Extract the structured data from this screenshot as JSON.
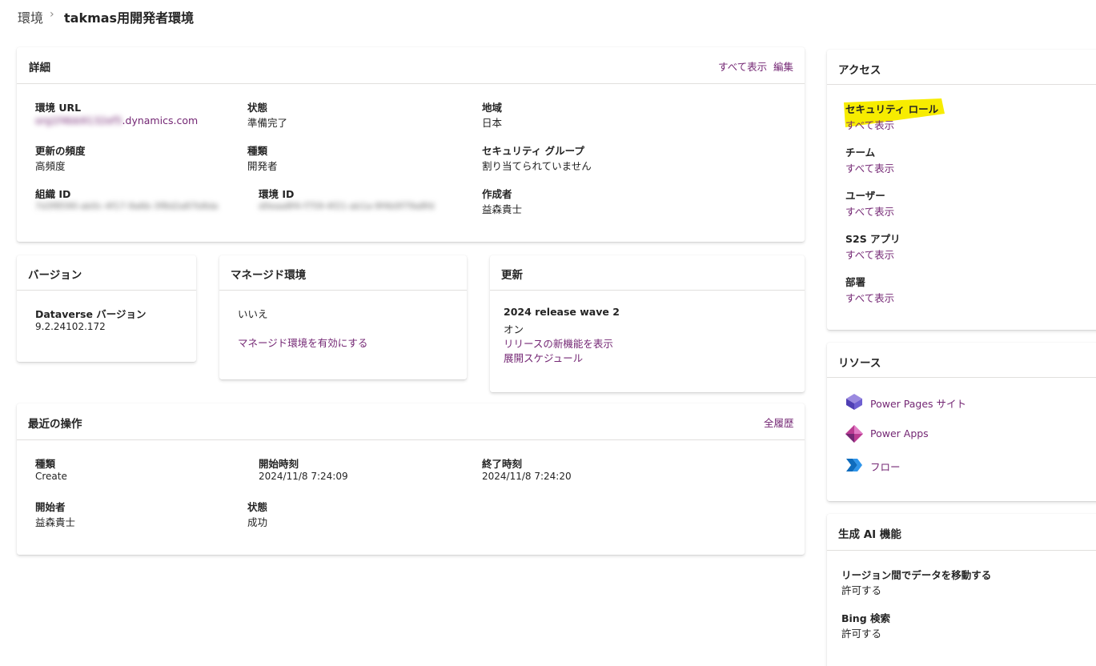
{
  "breadcrumb": {
    "parent": "環境",
    "separator": "›",
    "current": "takmas用開発者環境"
  },
  "details": {
    "title": "詳細",
    "show_all": "すべて表示",
    "edit": "編集",
    "env_url_label": "環境 URL",
    "env_url_prefix": "org1f4bb9132ef5",
    "env_url_suffix": ".dynamics.com",
    "state_label": "状態",
    "state_value": "準備完了",
    "region_label": "地域",
    "region_value": "日本",
    "update_freq_label": "更新の頻度",
    "update_freq_value": "高頻度",
    "type_label": "種類",
    "type_value": "開発者",
    "security_group_label": "セキュリティ グループ",
    "security_group_value": "割り当てられていません",
    "org_id_label": "組織 ID",
    "org_id_value": "7d3f8590-ab0c-4f17-9a6b-3f8d2a87b8da",
    "env_id_label": "環境 ID",
    "env_id_value": "d0eaa8f4-f759-4f21-ab1a-9f4b0f79a8fd",
    "creator_label": "作成者",
    "creator_value": "益森貴士"
  },
  "version": {
    "title": "バージョン",
    "dataverse_label": "Dataverse バージョン",
    "dataverse_value": "9.2.24102.172"
  },
  "managed": {
    "title": "マネージド環境",
    "value": "いいえ",
    "enable_link": "マネージド環境を有効にする"
  },
  "updates": {
    "title": "更新",
    "wave_label": "2024 release wave 2",
    "wave_value": "オン",
    "new_features_link": "リリースの新機能を表示",
    "schedule_link": "展開スケジュール"
  },
  "recent": {
    "title": "最近の操作",
    "history_link": "全履歴",
    "type_label": "種類",
    "type_value": "Create",
    "start_label": "開始時刻",
    "start_value": "2024/11/8 7:24:09",
    "end_label": "終了時刻",
    "end_value": "2024/11/8 7:24:20",
    "initiator_label": "開始者",
    "initiator_value": "益森貴士",
    "state_label": "状態",
    "state_value": "成功"
  },
  "access": {
    "title": "アクセス",
    "items": [
      {
        "label": "セキュリティ ロール",
        "link": "すべて表示"
      },
      {
        "label": "チーム",
        "link": "すべて表示"
      },
      {
        "label": "ユーザー",
        "link": "すべて表示"
      },
      {
        "label": "S2S アプリ",
        "link": "すべて表示"
      },
      {
        "label": "部署",
        "link": "すべて表示"
      }
    ],
    "highlight_color": "#f7ec00"
  },
  "resources": {
    "title": "リソース",
    "items": [
      {
        "label": "Power Pages サイト",
        "icon": "power-pages-icon"
      },
      {
        "label": "Power Apps",
        "icon": "power-apps-icon"
      },
      {
        "label": "フロー",
        "icon": "power-automate-icon"
      }
    ]
  },
  "genai": {
    "title": "生成 AI 機能",
    "move_data_label": "リージョン間でデータを移動する",
    "move_data_value": "許可する",
    "bing_label": "Bing 検索",
    "bing_value": "許可する"
  },
  "colors": {
    "link": "#742774",
    "text": "#242424",
    "divider": "#e1dfdd"
  }
}
